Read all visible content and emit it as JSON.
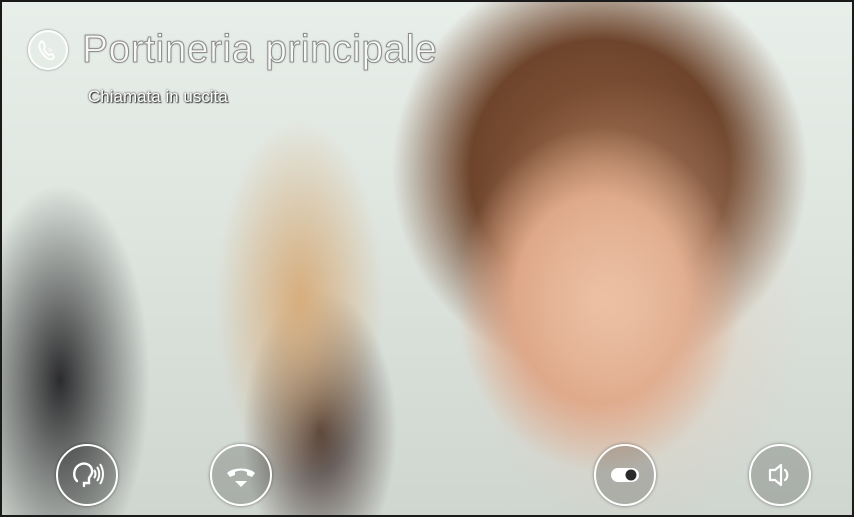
{
  "call": {
    "title": "Portineria principale",
    "status": "Chiamata in uscita"
  },
  "controls": [
    {
      "name": "talk-button",
      "icon": "talk-icon"
    },
    {
      "name": "hangup-button",
      "icon": "hangup-icon"
    },
    {
      "name": "video-toggle-button",
      "icon": "toggle-icon"
    },
    {
      "name": "speaker-button",
      "icon": "speaker-icon"
    }
  ],
  "colors": {
    "foreground": "#ffffff",
    "hangup_accent": "#ffffff"
  }
}
